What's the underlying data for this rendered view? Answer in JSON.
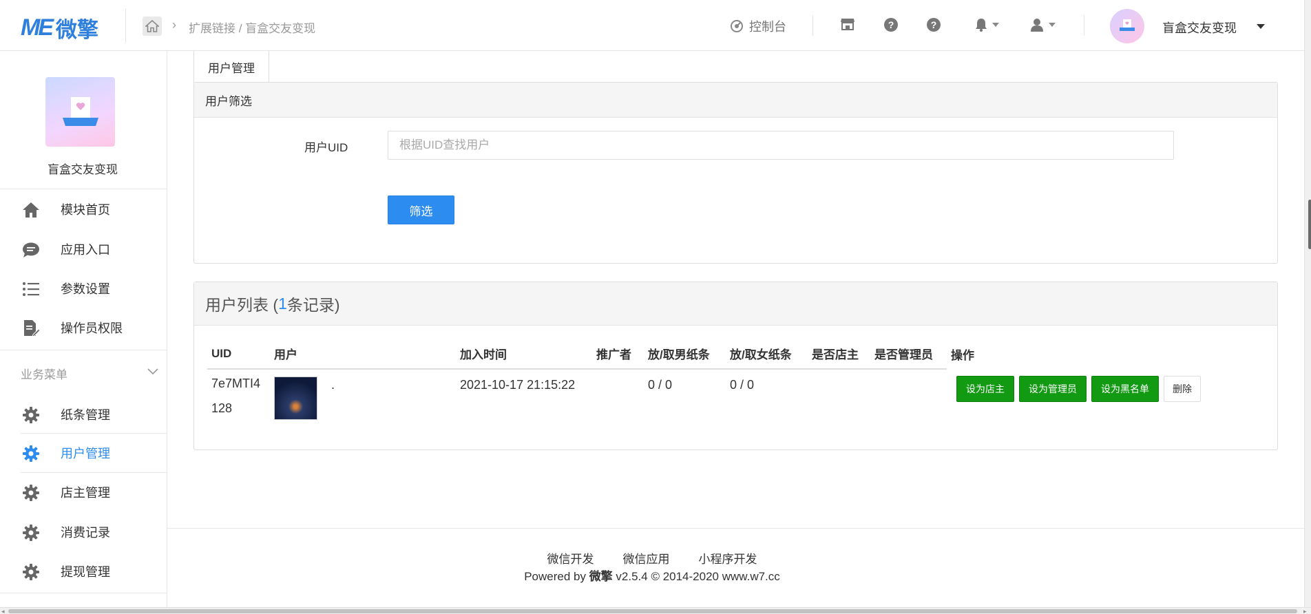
{
  "header": {
    "logo_mark": "ME",
    "logo_text": "微擎",
    "breadcrumb": "扩展链接 / 盲盒交友变现",
    "console_label": "控制台",
    "user_name": "盲盒交友变现"
  },
  "sidebar": {
    "app_name": "盲盒交友变现",
    "items": [
      {
        "label": "模块首页",
        "icon": "home-icon"
      },
      {
        "label": "应用入口",
        "icon": "chat-bubble-icon"
      },
      {
        "label": "参数设置",
        "icon": "list-settings-icon"
      },
      {
        "label": "操作员权限",
        "icon": "document-edit-icon"
      }
    ],
    "section_label": "业务菜单",
    "business_items": [
      {
        "label": "纸条管理",
        "icon": "gear-icon"
      },
      {
        "label": "用户管理",
        "icon": "gear-icon",
        "active": true
      },
      {
        "label": "店主管理",
        "icon": "gear-icon"
      },
      {
        "label": "消费记录",
        "icon": "gear-icon"
      },
      {
        "label": "提现管理",
        "icon": "gear-icon"
      }
    ]
  },
  "main": {
    "tab_label": "用户管理",
    "filter": {
      "title": "用户筛选",
      "uid_label": "用户UID",
      "uid_placeholder": "根据UID查找用户",
      "uid_value": "",
      "submit_label": "筛选"
    },
    "list": {
      "title_prefix": "用户列表 (",
      "count": "1",
      "title_suffix": "条记录)",
      "columns": [
        "UID",
        "用户",
        "加入时间",
        "推广者",
        "放/取男纸条",
        "放/取女纸条",
        "是否店主",
        "是否管理员",
        "操作"
      ],
      "rows": [
        {
          "uid": "7e7MTI4128",
          "nickname": ".",
          "join_time": "2021-10-17 21:15:22",
          "promoter": "",
          "male_notes": "0 / 0",
          "female_notes": "0 / 0",
          "is_owner": "",
          "is_admin": "",
          "actions": {
            "set_owner": "设为店主",
            "set_admin": "设为管理员",
            "set_blacklist": "设为黑名单",
            "delete": "删除"
          }
        }
      ]
    }
  },
  "footer": {
    "links": [
      "微信开发",
      "微信应用",
      "小程序开发"
    ],
    "powered_prefix": "Powered by ",
    "powered_brand": "微擎",
    "powered_suffix": " v2.5.4 © 2014-2020 www.w7.cc"
  },
  "colors": {
    "primary": "#2d8cf0",
    "success": "#139a13",
    "logo": "#2f7fdc"
  }
}
